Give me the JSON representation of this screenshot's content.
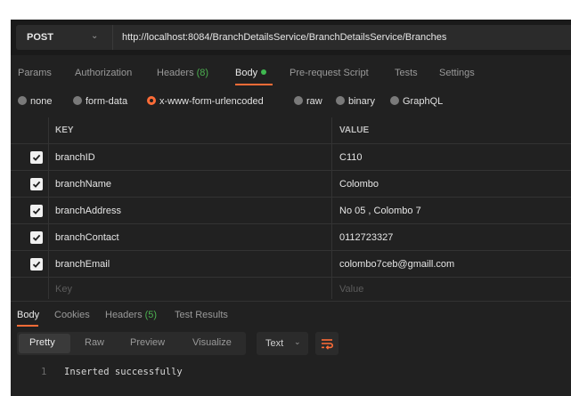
{
  "request": {
    "method": "POST",
    "url": "http://localhost:8084/BranchDetailsService/BranchDetailsService/Branches"
  },
  "request_tabs": [
    {
      "label": "Params"
    },
    {
      "label": "Authorization"
    },
    {
      "label": "Headers",
      "count": "(8)"
    },
    {
      "label": "Body"
    },
    {
      "label": "Pre-request Script"
    },
    {
      "label": "Tests"
    },
    {
      "label": "Settings"
    }
  ],
  "body_types": [
    "none",
    "form-data",
    "x-www-form-urlencoded",
    "raw",
    "binary",
    "GraphQL"
  ],
  "selected_body_type": "x-www-form-urlencoded",
  "table": {
    "headers": {
      "key": "KEY",
      "value": "VALUE"
    },
    "rows": [
      {
        "key": "branchID",
        "value": "C110",
        "checked": true
      },
      {
        "key": "branchName",
        "value": "Colombo",
        "checked": true
      },
      {
        "key": "branchAddress",
        "value": "No 05 , Colombo 7",
        "checked": true
      },
      {
        "key": "branchContact",
        "value": "0112723327",
        "checked": true
      },
      {
        "key": "branchEmail",
        "value": "colombo7ceb@gmaill.com",
        "checked": true
      }
    ],
    "placeholder": {
      "key": "Key",
      "value": "Value"
    }
  },
  "response_tabs": [
    {
      "label": "Body"
    },
    {
      "label": "Cookies"
    },
    {
      "label": "Headers",
      "count": "(5)"
    },
    {
      "label": "Test Results"
    }
  ],
  "response_view": {
    "modes": [
      "Pretty",
      "Raw",
      "Preview",
      "Visualize"
    ],
    "active_mode": "Pretty",
    "format": "Text"
  },
  "response_body": {
    "line_number": "1",
    "content": "Inserted successfully"
  },
  "colors": {
    "accent": "#ff6c37",
    "success": "#3fb950",
    "background": "#212121"
  }
}
